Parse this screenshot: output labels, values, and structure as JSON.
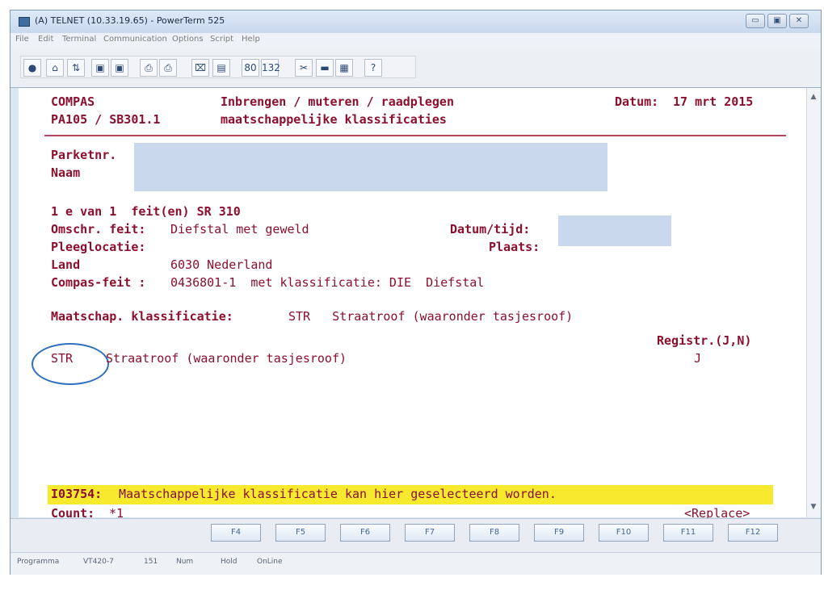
{
  "window": {
    "title": "(A) TELNET (10.33.19.65) - PowerTerm 525",
    "controls": {
      "minimize": "▭",
      "maximize": "▣",
      "close": "✕"
    }
  },
  "menu": {
    "items": [
      "File",
      "Edit",
      "Terminal",
      "Communication",
      "Options",
      "Script",
      "Help"
    ]
  },
  "toolbar": {
    "buttons": [
      "●",
      "⌂",
      "⇅",
      "▣",
      "▣",
      "⎙",
      "⎙",
      "⌧",
      "▤",
      "80",
      "132",
      "✂",
      "▬",
      "▦",
      "?"
    ]
  },
  "terminal": {
    "header": {
      "app": "COMPAS",
      "module": "PA105 / SB301.1",
      "title_1": "Inbrengen / muteren / raadplegen",
      "title_2": "maatschappelijke klassificaties",
      "date_label": "Datum:",
      "date_value": "17 mrt 2015"
    },
    "fields": {
      "parketnr_label": "Parketnr.",
      "naam_label": "Naam",
      "feit_range": "1 e van 1  feit(en) SR 310",
      "omschr_label": "Omschr. feit:",
      "omschr_value": "Diefstal met geweld",
      "datum_tijd_label": "Datum/tijd:",
      "pleeglocatie_label": "Pleeglocatie:",
      "plaats_label": "Plaats:",
      "land_label": "Land",
      "land_value": "6030 Nederland",
      "compas_feit_label": "Compas-feit :",
      "compas_feit_value": "0436801-1  met klassificatie: DIE  Diefstal",
      "maatschap_label": "Maatschap. klassificatie:",
      "maatschap_value": "STR   Straatroof (waaronder tasjesroof)",
      "registr_label": "Registr.(J,N)",
      "entry_code": "STR",
      "entry_desc": "Straatroof (waaronder tasjesroof)",
      "entry_registr": "J"
    },
    "message": {
      "code": "I03754:",
      "text": "Maatschappelijke klassificatie kan hier geselecteerd worden."
    },
    "count_label": "Count:",
    "count_value": "*1",
    "mode": "<Replace>"
  },
  "function_keys": [
    "F4",
    "F5",
    "F6",
    "F7",
    "F8",
    "F9",
    "F10",
    "F11",
    "F12"
  ],
  "status": {
    "items": [
      "Programma",
      "VT420-7",
      "151",
      "Num",
      "Hold",
      "OnLine"
    ]
  }
}
